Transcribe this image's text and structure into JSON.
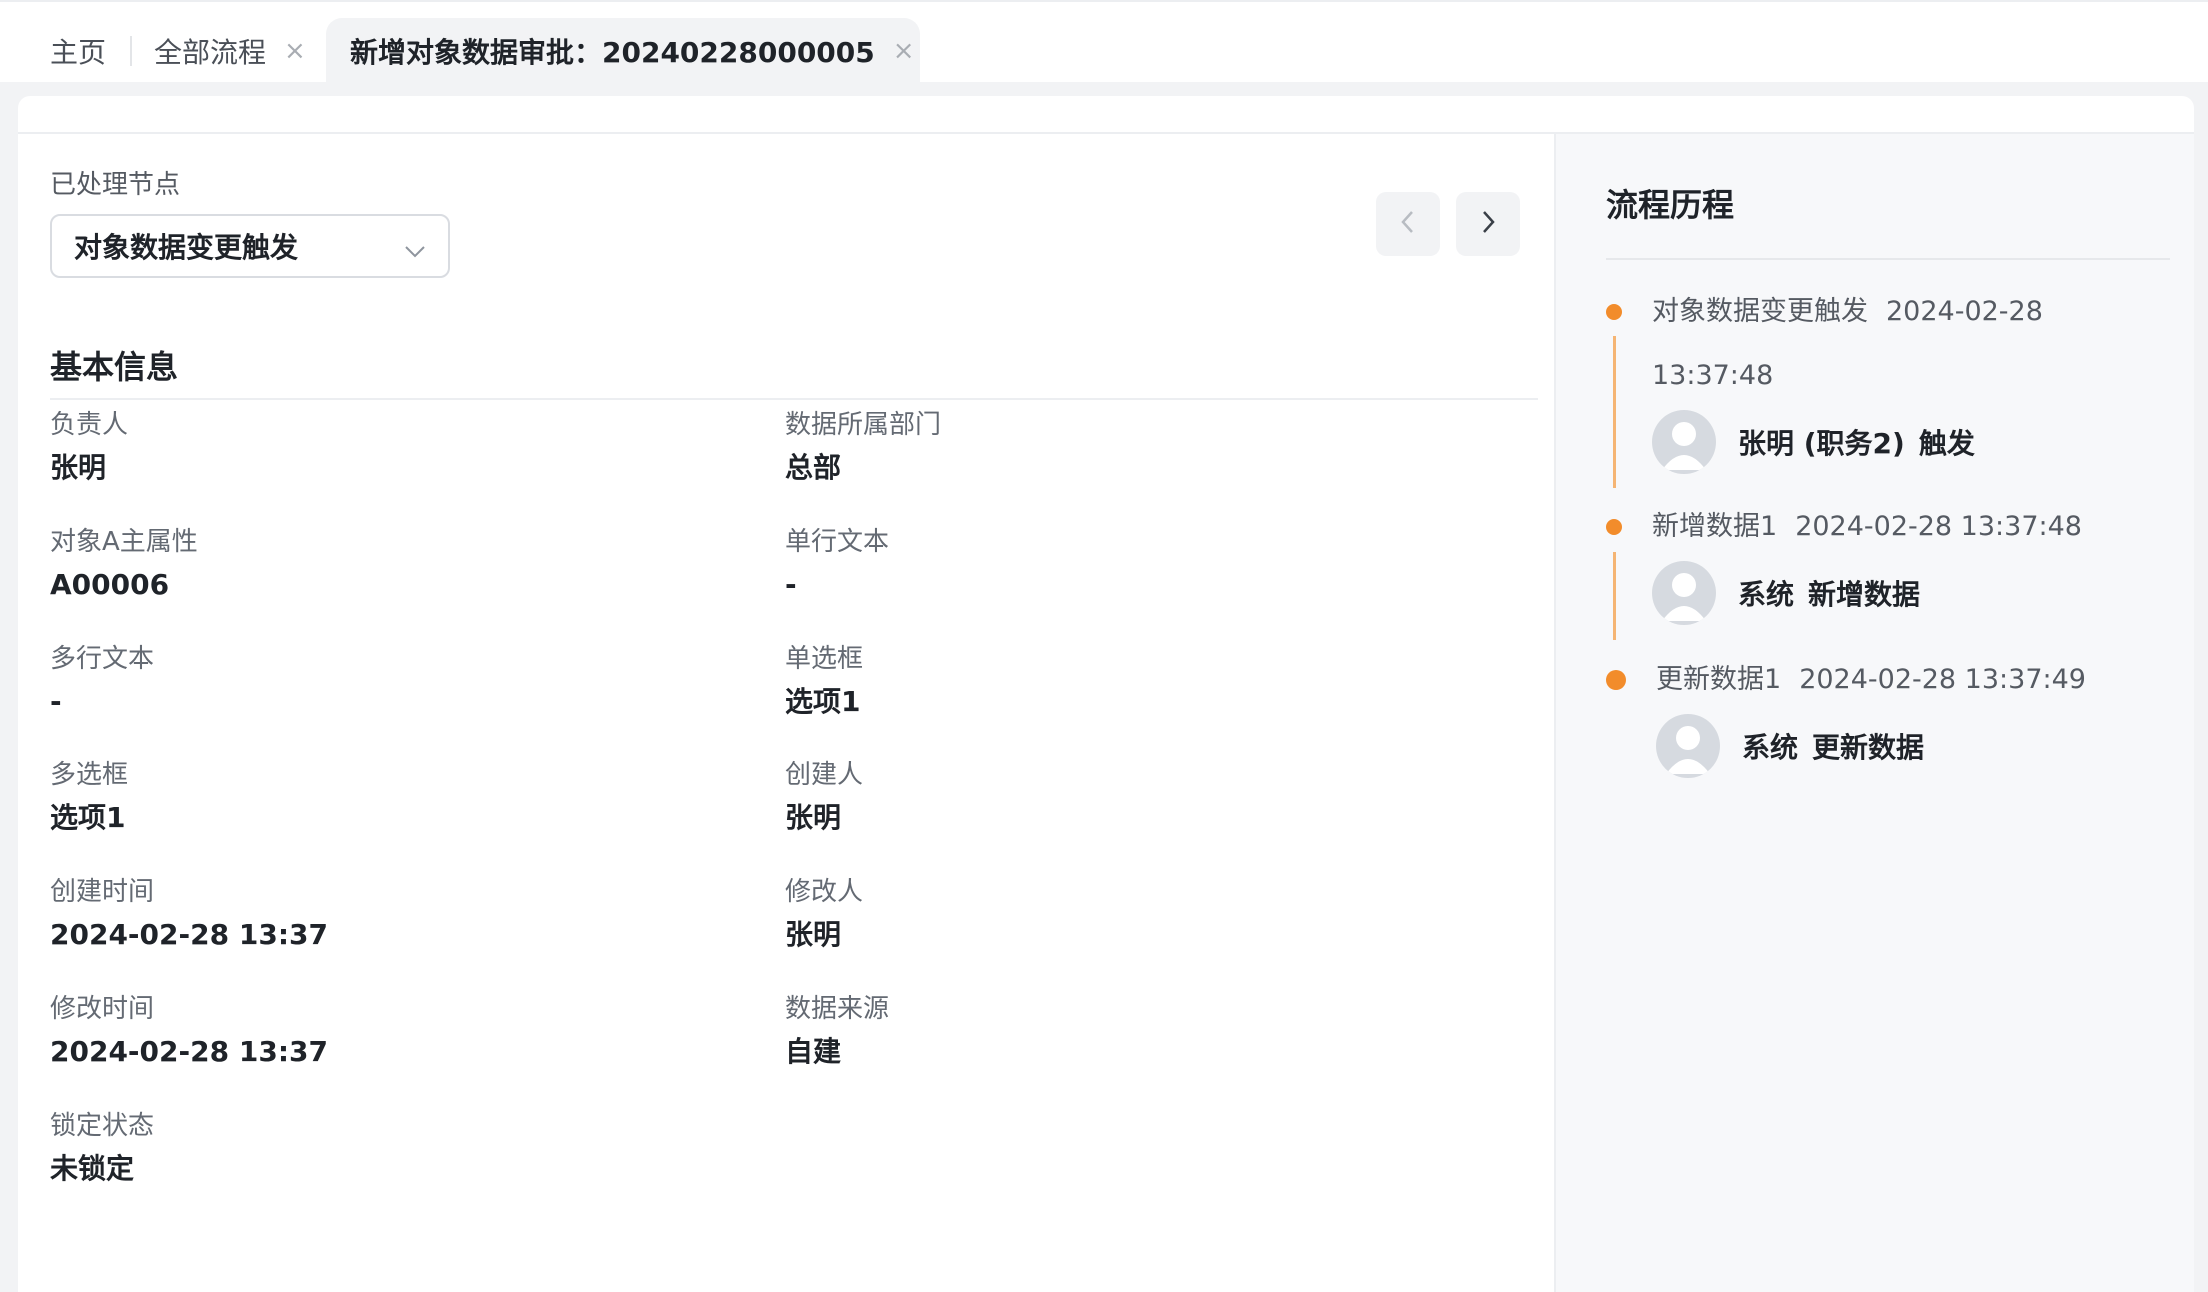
{
  "tabs": {
    "home": "主页",
    "all_process": "全部流程",
    "active": "新增对象数据审批：20240228000005"
  },
  "left": {
    "processed_nodes_label": "已处理节点",
    "selected_node": "对象数据变更触发",
    "section_title": "基本信息",
    "fields": [
      {
        "label": "负责人",
        "value": "张明"
      },
      {
        "label": "数据所属部门",
        "value": "总部"
      },
      {
        "label": "对象A主属性",
        "value": "A00006"
      },
      {
        "label": "单行文本",
        "value": "-"
      },
      {
        "label": "多行文本",
        "value": "-"
      },
      {
        "label": "单选框",
        "value": "选项1"
      },
      {
        "label": "多选框",
        "value": "选项1"
      },
      {
        "label": "创建人",
        "value": "张明"
      },
      {
        "label": "创建时间",
        "value": "2024-02-28 13:37"
      },
      {
        "label": "修改人",
        "value": "张明"
      },
      {
        "label": "修改时间",
        "value": "2024-02-28 13:37"
      },
      {
        "label": "数据来源",
        "value": "自建"
      },
      {
        "label": "锁定状态",
        "value": "未锁定"
      }
    ]
  },
  "history": {
    "title": "流程历程",
    "items": [
      {
        "node": "对象数据变更触发",
        "time": "2024-02-28 13:37:48",
        "user": "张明 (职务2)",
        "action": "触发"
      },
      {
        "node": "新增数据1",
        "time": "2024-02-28 13:37:48",
        "user": "系统",
        "action": "新增数据"
      },
      {
        "node": "更新数据1",
        "time": "2024-02-28 13:37:49",
        "user": "系统",
        "action": "更新数据"
      }
    ]
  },
  "colors": {
    "accent": "#f28c2b",
    "timeline_line": "#f5b574"
  },
  "icons": [
    "close-icon",
    "chevron-down-icon",
    "chevron-left-icon",
    "chevron-right-icon",
    "avatar-placeholder-icon"
  ]
}
